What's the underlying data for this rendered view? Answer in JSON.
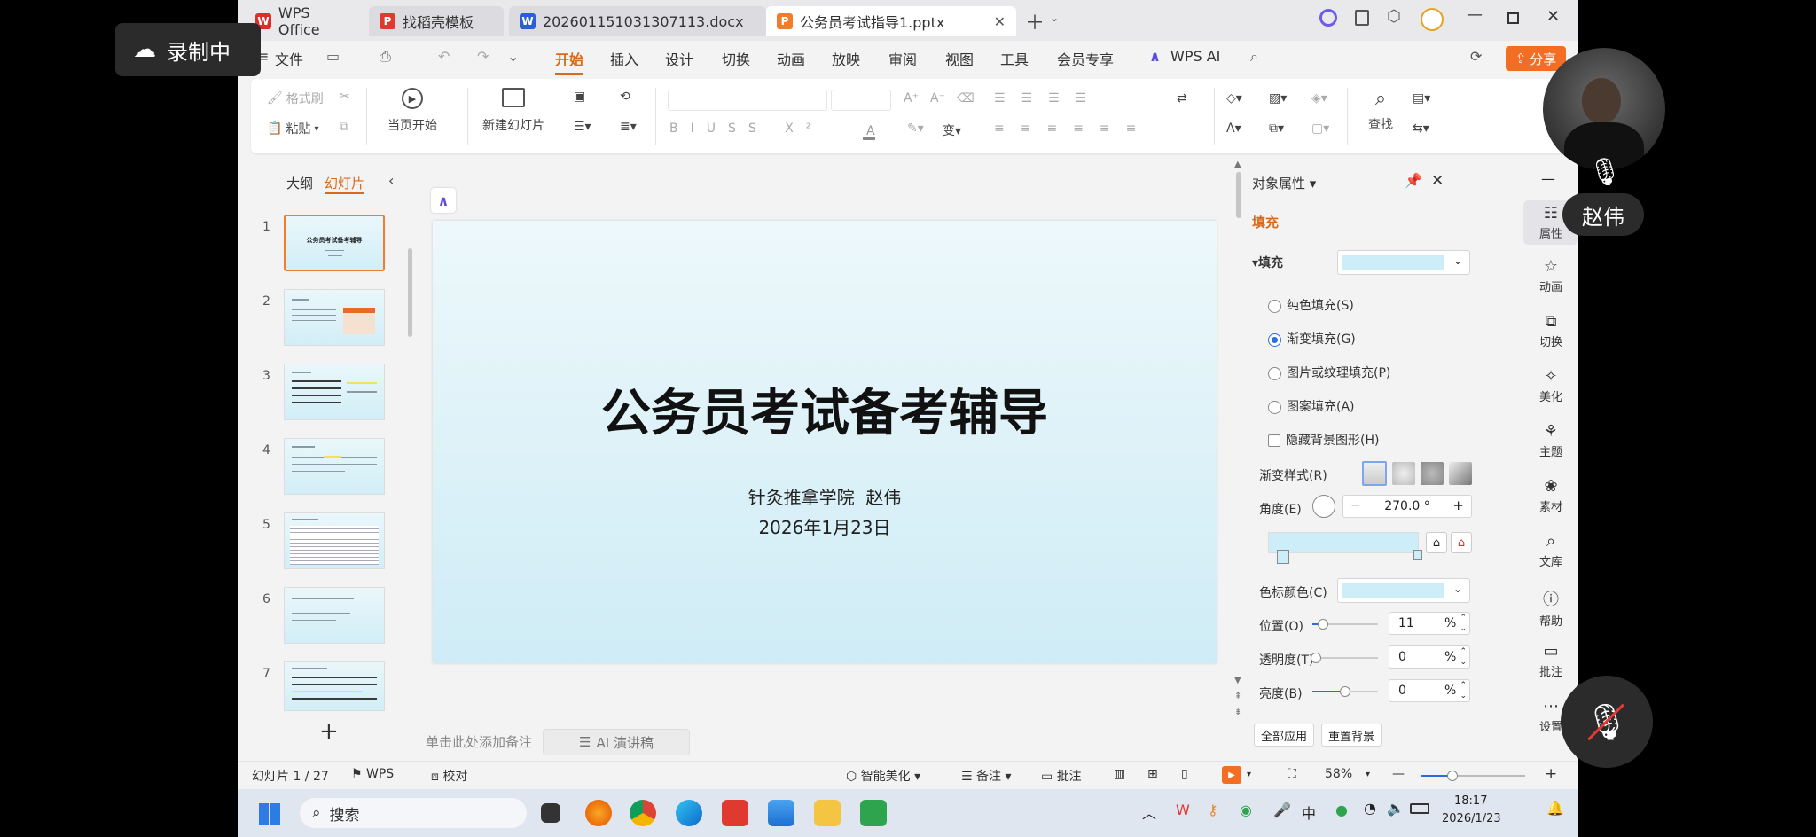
{
  "tabs": [
    {
      "label": "WPS Office",
      "icon": "W",
      "color": "#d9302c"
    },
    {
      "label": "找稻壳模板",
      "icon": "P",
      "color": "#e0392f"
    },
    {
      "label": "202601151031307113.docx",
      "icon": "W",
      "color": "#2b5fd6"
    },
    {
      "label": "公务员考试指导1.pptx",
      "icon": "P",
      "color": "#f07d2c"
    }
  ],
  "menu": {
    "file": "文件",
    "items": [
      "开始",
      "插入",
      "设计",
      "切换",
      "动画",
      "放映",
      "审阅",
      "视图",
      "工具",
      "会员专享"
    ],
    "ai": "WPS AI",
    "share": "分享"
  },
  "ribbon": {
    "format_brush": "格式刷",
    "paste": "粘贴",
    "play_from_current": "当页开始",
    "new_slide": "新建幻灯片",
    "find": "查找"
  },
  "leftpane": {
    "outline": "大纲",
    "slides": "幻灯片",
    "add": "+",
    "thumbs": [
      "1",
      "2",
      "3",
      "4",
      "5",
      "6",
      "7"
    ],
    "thumb1_title": "公务员考试备考辅导"
  },
  "slide": {
    "title": "公务员考试备考辅导",
    "subtitle1": "针灸推拿学院  赵伟",
    "subtitle2": "2026年1月23日"
  },
  "notes_placeholder": "单击此处添加备注",
  "ai_speech": "AI 演讲稿",
  "rightpane": {
    "title": "对象属性",
    "tab_fill": "填充",
    "section_fill": "填充",
    "options": [
      "纯色填充(S)",
      "渐变填充(G)",
      "图片或纹理填充(P)",
      "图案填充(A)"
    ],
    "hide_bg": "隐藏背景图形(H)",
    "gradient_style": "渐变样式(R)",
    "angle_label": "角度(E)",
    "angle_value": "270.0 °",
    "stop_color": "色标颜色(C)",
    "position_label": "位置(O)",
    "position_value": "11",
    "transparency_label": "透明度(T)",
    "transparency_value": "0",
    "brightness_label": "亮度(B)",
    "brightness_value": "0",
    "percent": "%",
    "apply_all": "全部应用",
    "reset_bg": "重置背景",
    "fill_color": "#cdeef8",
    "position_level": 0.11,
    "transparency_level": 0,
    "brightness_level": 0.5
  },
  "sidebar": [
    "属性",
    "动画",
    "切换",
    "美化",
    "主题",
    "素材",
    "文库",
    "帮助",
    "批注",
    "设置"
  ],
  "status": {
    "slide_count": "幻灯片 1 / 27",
    "wps": "WPS",
    "proof": "校对",
    "beautify": "智能美化",
    "notes": "备注",
    "comment": "批注",
    "zoom": "58%"
  },
  "taskbar": {
    "search": "搜索",
    "time": "18:17",
    "date": "2026/1/23",
    "ime": "中"
  },
  "overlay": {
    "recording": "录制中",
    "user": "赵伟"
  }
}
